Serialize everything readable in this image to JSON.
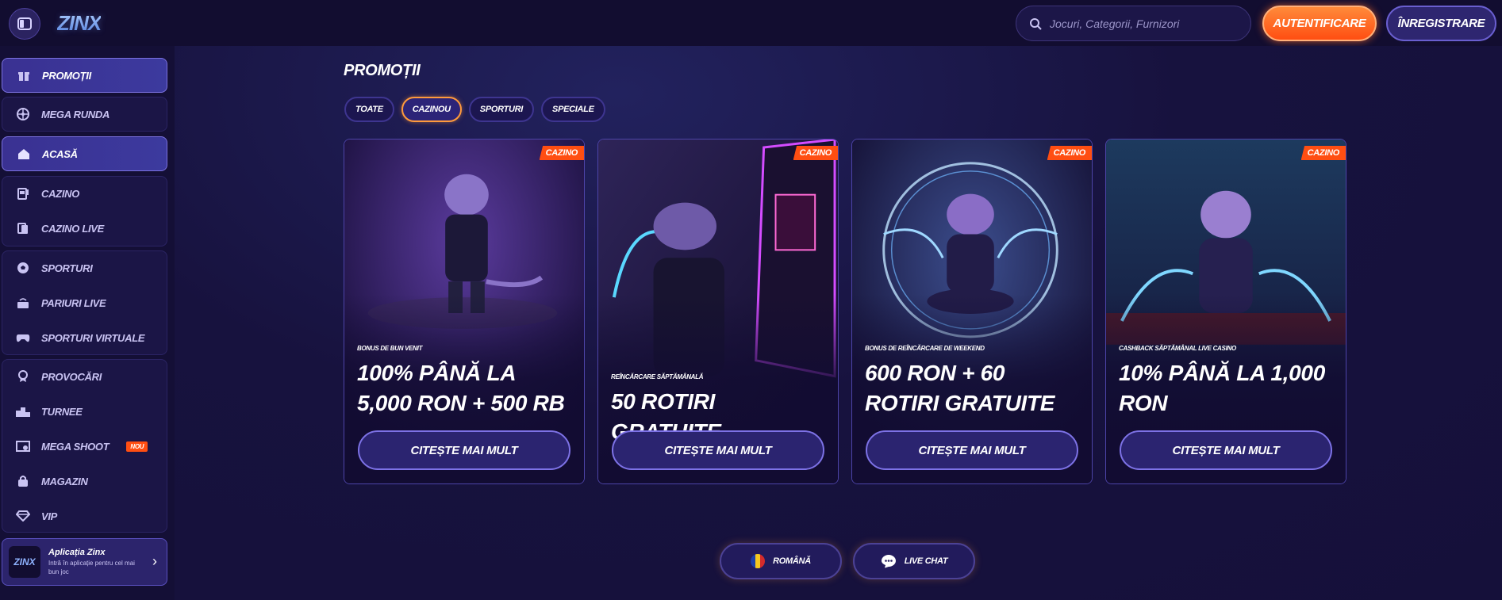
{
  "header": {
    "logo": "ZINX",
    "search_placeholder": "Jocuri, Categorii, Furnizori",
    "login_label": "AUTENTIFICARE",
    "register_label": "ÎNREGISTRARE"
  },
  "sidebar": {
    "items": [
      {
        "label": "PROMOȚII",
        "icon": "gift-icon"
      },
      {
        "label": "MEGA RUNDA",
        "icon": "wheel-icon"
      },
      {
        "label": "ACASĂ",
        "icon": "home-icon"
      },
      {
        "label": "CAZINO",
        "icon": "slot-machine-icon"
      },
      {
        "label": "CAZINO LIVE",
        "icon": "cards-icon"
      },
      {
        "label": "SPORTURI",
        "icon": "football-icon"
      },
      {
        "label": "PARIURI LIVE",
        "icon": "live-icon"
      },
      {
        "label": "SPORTURI VIRTUALE",
        "icon": "gamepad-icon"
      },
      {
        "label": "PROVOCĂRI",
        "icon": "medal-icon"
      },
      {
        "label": "TURNEE",
        "icon": "podium-icon"
      },
      {
        "label": "MEGA SHOOT",
        "icon": "goal-icon",
        "badge": "NOU"
      },
      {
        "label": "MAGAZIN",
        "icon": "bag-icon"
      },
      {
        "label": "VIP",
        "icon": "diamond-icon"
      }
    ],
    "app": {
      "logo": "ZINX",
      "title": "Aplicația Zinx",
      "subtitle": "Intră în aplicație pentru cel mai bun joc"
    }
  },
  "main": {
    "title": "PROMOȚII",
    "tabs": [
      "TOATE",
      "CAZINOU",
      "SPORTURI",
      "SPECIALE"
    ],
    "active_tab": "CAZINOU",
    "cards": [
      {
        "tag": "CAZINO",
        "kicker": "BONUS DE BUN VENIT",
        "title": "100% PÂNĂ LA 5,000 RON + 500 RB",
        "button": "CITEȘTE MAI MULT"
      },
      {
        "tag": "CAZINO",
        "kicker": "REÎNCĂRCARE SĂPTĂMÂNALĂ",
        "title": "50 ROTIRI GRATUITE",
        "button": "CITEȘTE MAI MULT"
      },
      {
        "tag": "CAZINO",
        "kicker": "BONUS DE REÎNCĂRCARE DE WEEKEND",
        "title": "600 RON + 60 ROTIRI GRATUITE",
        "button": "CITEȘTE MAI MULT"
      },
      {
        "tag": "CAZINO",
        "kicker": "CASHBACK SĂPTĂMÂNAL LIVE CASINO",
        "title": "10% PÂNĂ LA 1,000 RON",
        "button": "CITEȘTE MAI MULT"
      }
    ]
  },
  "footer": {
    "language_label": "ROMÂNĂ",
    "chat_label": "LIVE CHAT"
  },
  "colors": {
    "background": "#15103a",
    "accent_orange": "#ff4e12",
    "accent_purple": "#7d72e6"
  }
}
